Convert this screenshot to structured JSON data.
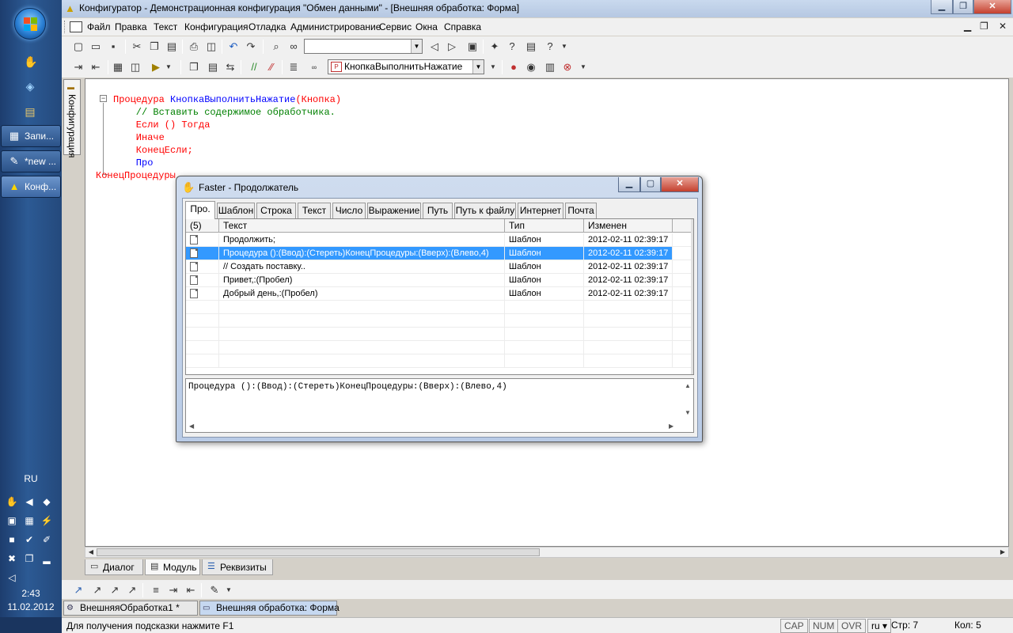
{
  "taskbar": {
    "buttons": [
      {
        "label": "Запи...",
        "icon": "notes-icon"
      },
      {
        "label": "*new ...",
        "icon": "notepad-icon"
      },
      {
        "label": "Конф...",
        "icon": "1c-icon"
      }
    ],
    "language": "RU",
    "time": "2:43",
    "date": "11.02.2012"
  },
  "window": {
    "title": "Конфигуратор - Демонстрационная конфигурация \"Обмен данными\" - [Внешняя обработка: Форма]"
  },
  "menu": [
    "Файл",
    "Правка",
    "Текст",
    "Конфигурация",
    "Отладка",
    "Администрирование",
    "Сервис",
    "Окна",
    "Справка"
  ],
  "toolbar2": {
    "procedure_combo": "КнопкаВыполнитьНажатие"
  },
  "side_panel": {
    "label": "Конфигурация"
  },
  "editor": {
    "lines": [
      {
        "kw": "Процедура ",
        "id": "КнопкаВыполнитьНажатие",
        "rest": "(Кнопка)"
      },
      {
        "comment": "    // Вставить содержимое обработчика."
      },
      {
        "text": "    Если () Тогда"
      },
      {
        "text": "    Иначе"
      },
      {
        "text": "    КонецЕсли;"
      },
      {
        "text": "    Про"
      },
      {
        "text": "КонецПроцедуры"
      }
    ]
  },
  "bottom_tabs": [
    "Диалог",
    "Модуль",
    "Реквизиты"
  ],
  "window_tabs": [
    "ВнешняяОбработка1 *",
    "Внешняя обработка: Форма"
  ],
  "status": {
    "hint": "Для получения подсказки нажмите F1",
    "cap": "CAP",
    "num": "NUM",
    "ovr": "OVR",
    "lang": "ru",
    "line": "Стр: 7",
    "col": "Кол: 5"
  },
  "dialog": {
    "title": "Faster - Продолжатель",
    "tabs": [
      "Про.",
      "Шаблон",
      "Строка",
      "Текст",
      "Число",
      "Выражение",
      "Путь",
      "Путь к файлу",
      "Интернет",
      "Почта"
    ],
    "columns": {
      "count": "(5)",
      "text": "Текст",
      "type": "Тип",
      "modified": "Изменен"
    },
    "rows": [
      {
        "text": "Продолжить;",
        "type": "Шаблон",
        "modified": "2012-02-11 02:39:17"
      },
      {
        "text": "Процедура ():(Ввод):(Стереть)КонецПроцедуры:(Вверх):(Влево,4)",
        "type": "Шаблон",
        "modified": "2012-02-11 02:39:17"
      },
      {
        "text": "// Создать поставку..",
        "type": "Шаблон",
        "modified": "2012-02-11 02:39:17"
      },
      {
        "text": "Привет,:(Пробел)",
        "type": "Шаблон",
        "modified": "2012-02-11 02:39:17"
      },
      {
        "text": "Добрый день,:(Пробел)",
        "type": "Шаблон",
        "modified": "2012-02-11 02:39:17"
      }
    ],
    "selected_row": 1,
    "preview": "Процедура ():(Ввод):(Стереть)КонецПроцедуры:(Вверх):(Влево,4)"
  }
}
